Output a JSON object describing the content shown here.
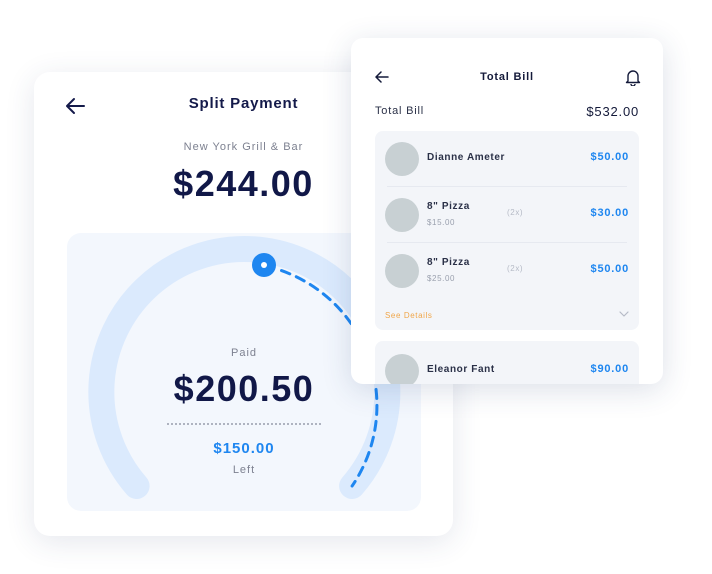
{
  "split_payment": {
    "title": "Split Payment",
    "restaurant": "New York Grill & Bar",
    "total": "$244.00",
    "paid_label": "Paid",
    "paid_amount": "$200.50",
    "left_amount": "$150.00",
    "left_label": "Left",
    "colors": {
      "accent": "#1e86f0",
      "track": "#dbeafd",
      "panel": "#f3f7fd",
      "heading": "#111848"
    },
    "icons": {
      "back": "arrow-left-icon"
    }
  },
  "total_bill": {
    "title": "Total Bill",
    "total_label": "Total Bill",
    "total_value": "$532.00",
    "icons": {
      "back": "arrow-left-icon",
      "notifications": "bell-icon",
      "expand": "chevron-down-icon"
    },
    "items": [
      {
        "name": "Dianne Ameter",
        "amount": "$50.00"
      },
      {
        "name": "8\" Pizza",
        "price": "$15.00",
        "qty": "(2x)",
        "amount": "$30.00"
      },
      {
        "name": "8\" Pizza",
        "price": "$25.00",
        "qty": "(2x)",
        "amount": "$50.00"
      }
    ],
    "see_details": "See Details",
    "second_group": [
      {
        "name": "Eleanor Fant",
        "amount": "$90.00"
      }
    ],
    "colors": {
      "link": "#f0a64a",
      "amount": "#1e86f0",
      "avatar": "#c8d0d3"
    }
  }
}
